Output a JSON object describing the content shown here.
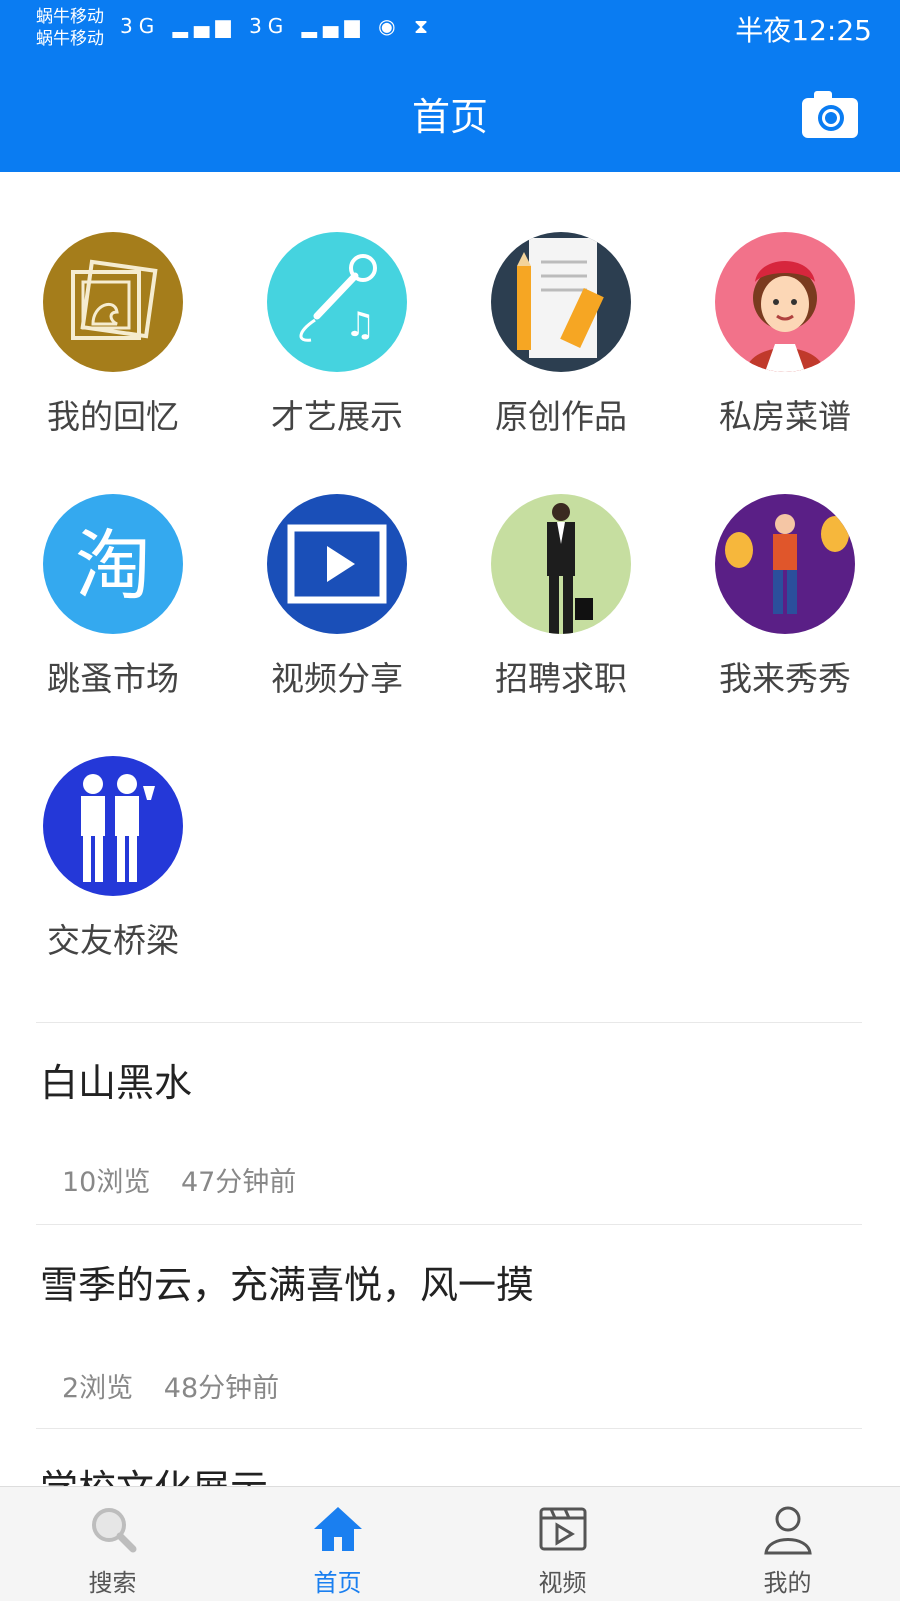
{
  "status_bar": {
    "carrier_line1": "蜗牛移动",
    "carrier_line2": "蜗牛移动",
    "signal_icons": "3G ▂▄▆ 3G ▂▄▆ ◉ ⧗",
    "time": "半夜12:25"
  },
  "header": {
    "title": "首页"
  },
  "categories": [
    {
      "label": "我的回忆",
      "color": "#a57d1b"
    },
    {
      "label": "才艺展示",
      "color": "#45d3df"
    },
    {
      "label": "原创作品",
      "color": "#2c3e50"
    },
    {
      "label": "私房菜谱",
      "color": "#f2728a"
    },
    {
      "label": "跳蚤市场",
      "color": "#34a9ef"
    },
    {
      "label": "视频分享",
      "color": "#1a4fb8"
    },
    {
      "label": "招聘求职",
      "color": "#c6dea0"
    },
    {
      "label": "我来秀秀",
      "color": "#5a1f86"
    },
    {
      "label": "交友桥梁",
      "color": "#2438d8"
    }
  ],
  "posts": [
    {
      "title": "白山黑水",
      "views": "10浏览",
      "time": "47分钟前"
    },
    {
      "title": "雪季的云，充满喜悦，风一摸",
      "views": "2浏览",
      "time": "48分钟前"
    },
    {
      "title": "学校文化展示"
    }
  ],
  "tabs": [
    {
      "label": "搜索"
    },
    {
      "label": "首页"
    },
    {
      "label": "视频"
    },
    {
      "label": "我的"
    }
  ],
  "colors": {
    "brand": "#0a7cf2",
    "active_tab": "#1a7ff0"
  }
}
